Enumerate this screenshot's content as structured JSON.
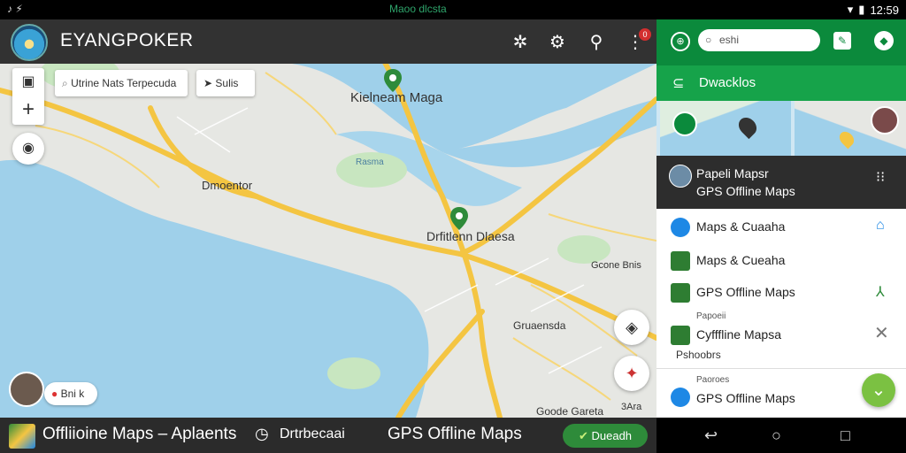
{
  "status_bar": {
    "left_icons": "♪ ⚡",
    "center_text": "Maoo dlcsta",
    "time": "12:59"
  },
  "header": {
    "title": "EYANGPOKER",
    "icons": [
      "gear-icon",
      "settings-icon",
      "search-icon",
      "more-icon"
    ],
    "badge": "0"
  },
  "map": {
    "chip_search": "Utrine Nats Terpecuda",
    "chip_directions": "Sulis",
    "labels": {
      "top": "Kielneam Maga",
      "left": "Dmoentor",
      "center": "Drfitlenn Dlaesa",
      "right_mid": "Gcone Bnis",
      "right_lower": "Gruaensda",
      "bottom": "Goode Gareta",
      "bottom_right": "3Ara",
      "water": "Rasma"
    },
    "user_chip": "Bni k"
  },
  "bottom_bar": {
    "item1": "Offliioine Maps – Aplaents",
    "item2": "Drtrbecaai",
    "item3": "GPS Offline Maps",
    "button": "Dueadh"
  },
  "panel": {
    "search_placeholder": "eshi",
    "section_title": "Dwacklos",
    "dark_row": {
      "line1": "Papeli Mapsr",
      "line2": "GPS Offline Maps"
    },
    "items": [
      {
        "label": "Maps & Cuaaha",
        "color": "#1e88e5"
      },
      {
        "label": "Maps & Cueaha",
        "color": "#2e7d32"
      },
      {
        "label": "GPS Offline Maps",
        "color": "#2e7d32"
      },
      {
        "label": "Cyfffline Mapsa",
        "small": "Papoeii",
        "sub": "Pshoobrs",
        "color": "#2e7d32"
      },
      {
        "label": "GPS Offline Maps",
        "small": "Paoroes",
        "color": "#1e88e5"
      }
    ]
  },
  "colors": {
    "water": "#9fd0ea",
    "road": "#f4c542",
    "park": "#c8e6c0",
    "header": "#323232",
    "panel_green": "#0b8a3c"
  }
}
